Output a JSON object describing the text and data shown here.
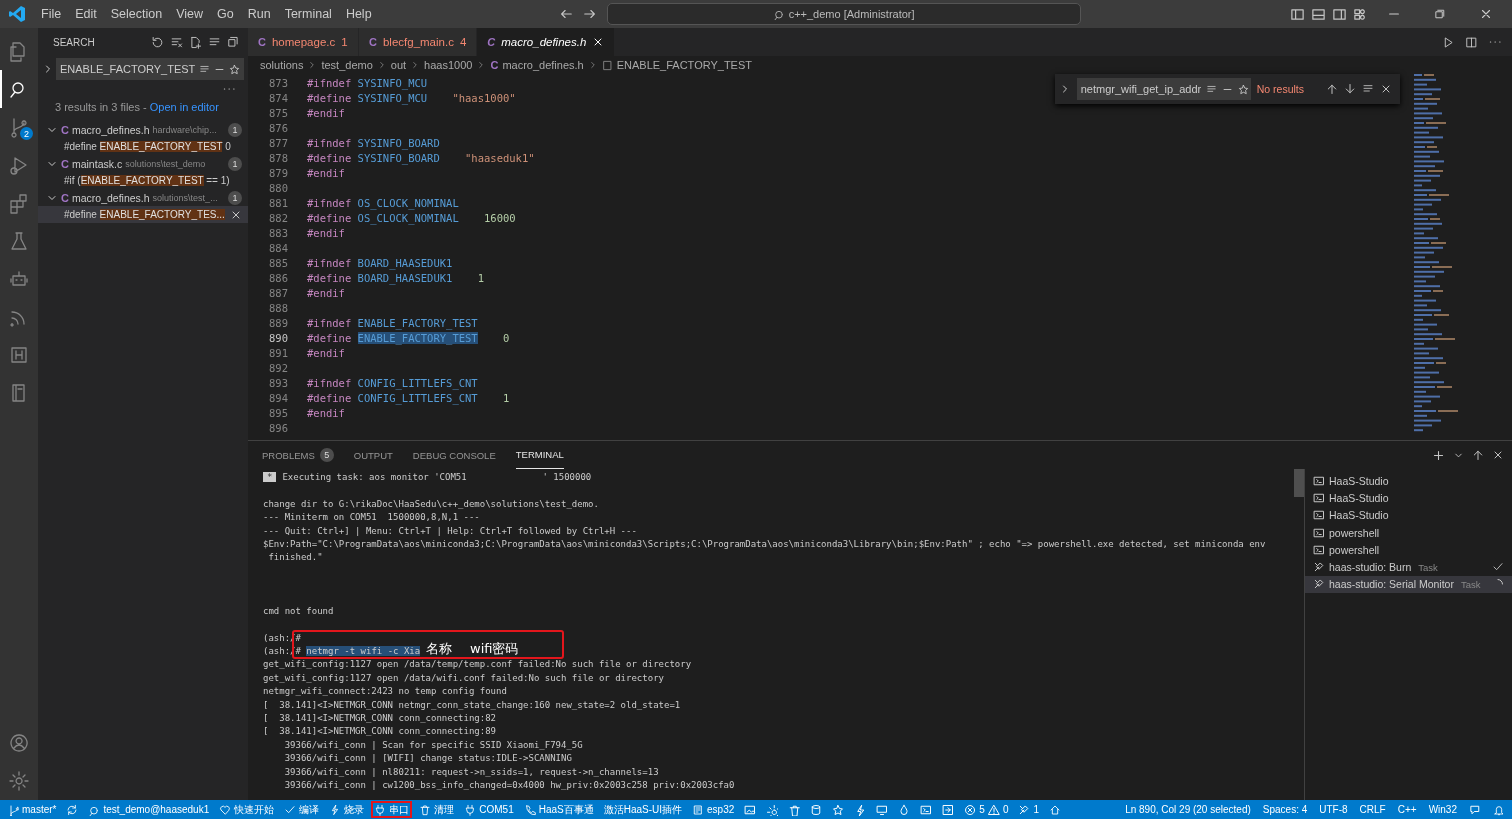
{
  "menu": [
    "File",
    "Edit",
    "Selection",
    "View",
    "Go",
    "Run",
    "Terminal",
    "Help"
  ],
  "command_center": "c++_demo [Administrator]",
  "activity": {
    "scm_badge": "2"
  },
  "sidebar": {
    "title": "SEARCH",
    "query": "ENABLE_FACTORY_TEST",
    "summary": "3 results in 3 files - ",
    "summary_link": "Open in editor",
    "results": [
      {
        "icon_text": "C",
        "file": "macro_defines.h",
        "path": "hardware\\chip...",
        "count": "1",
        "expanded": true,
        "matches": [
          {
            "before": "#define ",
            "match": "ENABLE_FACTORY_TEST",
            "after": "0",
            "selected": false
          }
        ]
      },
      {
        "icon_text": "C",
        "file": "maintask.c",
        "path": "solutions\\test_demo",
        "count": "1",
        "expanded": true,
        "matches": [
          {
            "before": "#if (",
            "match": "ENABLE_FACTORY_TEST",
            "after": "== 1)",
            "selected": false
          }
        ]
      },
      {
        "icon_text": "C",
        "file": "macro_defines.h",
        "path": "solutions\\test_...",
        "count": "1",
        "expanded": true,
        "matches": [
          {
            "before": "#define ",
            "match": "ENABLE_FACTORY_TES...",
            "selected": true
          }
        ]
      }
    ]
  },
  "tabs": [
    {
      "icon_text": "C",
      "label": "homepage.c",
      "badge": "1",
      "selected": false,
      "has_errors": true
    },
    {
      "icon_text": "C",
      "label": "blecfg_main.c",
      "badge": "4",
      "selected": false,
      "has_errors": true
    },
    {
      "icon_text": "C",
      "label": "macro_defines.h",
      "selected": true,
      "has_errors": false
    }
  ],
  "breadcrumb": [
    {
      "text": "solutions"
    },
    {
      "text": "test_demo"
    },
    {
      "text": "out"
    },
    {
      "text": "haas1000"
    },
    {
      "text": "macro_defines.h",
      "icon_text": "C"
    },
    {
      "text": "ENABLE_FACTORY_TEST",
      "kind": "symbol"
    }
  ],
  "find": {
    "query": "netmgr_wifi_get_ip_addr",
    "status": "No results"
  },
  "code": [
    {
      "n": "873",
      "kind": "guard",
      "directive": "#ifndef",
      "name": "SYSINFO_MCU",
      "current": false
    },
    {
      "n": "874",
      "kind": "string_define",
      "directive": "#define",
      "name": "SYSINFO_MCU",
      "value": "\"haas1000\"",
      "current": false
    },
    {
      "n": "875",
      "kind": "end",
      "directive": "#endif",
      "current": false
    },
    {
      "n": "876",
      "kind": "blank",
      "current": false
    },
    {
      "n": "877",
      "kind": "guard",
      "directive": "#ifndef",
      "name": "SYSINFO_BOARD",
      "current": false
    },
    {
      "n": "878",
      "kind": "string_define",
      "directive": "#define",
      "name": "SYSINFO_BOARD",
      "value": "\"haaseduk1\"",
      "current": false
    },
    {
      "n": "879",
      "kind": "end",
      "directive": "#endif",
      "current": false
    },
    {
      "n": "880",
      "kind": "blank",
      "current": false
    },
    {
      "n": "881",
      "kind": "guard",
      "directive": "#ifndef",
      "name": "OS_CLOCK_NOMINAL",
      "current": false
    },
    {
      "n": "882",
      "kind": "number_define",
      "directive": "#define",
      "name": "OS_CLOCK_NOMINAL",
      "value": "16000",
      "current": false
    },
    {
      "n": "883",
      "kind": "end",
      "directive": "#endif",
      "current": false
    },
    {
      "n": "884",
      "kind": "blank",
      "current": false
    },
    {
      "n": "885",
      "kind": "guard",
      "directive": "#ifndef",
      "name": "BOARD_HAASEDUK1",
      "current": false
    },
    {
      "n": "886",
      "kind": "number_define",
      "directive": "#define",
      "name": "BOARD_HAASEDUK1",
      "value": "1",
      "current": false
    },
    {
      "n": "887",
      "kind": "end",
      "directive": "#endif",
      "current": false
    },
    {
      "n": "888",
      "kind": "blank",
      "current": false
    },
    {
      "n": "889",
      "kind": "guard",
      "directive": "#ifndef",
      "name": "ENABLE_FACTORY_TEST",
      "current": false
    },
    {
      "n": "890",
      "kind": "number_define",
      "directive": "#define",
      "name": "ENABLE_FACTORY_TEST",
      "value": "0",
      "current": true
    },
    {
      "n": "891",
      "kind": "end",
      "directive": "#endif",
      "current": false
    },
    {
      "n": "892",
      "kind": "blank",
      "current": false
    },
    {
      "n": "893",
      "kind": "guard",
      "directive": "#ifndef",
      "name": "CONFIG_LITTLEFS_CNT",
      "current": false
    },
    {
      "n": "894",
      "kind": "number_define",
      "directive": "#define",
      "name": "CONFIG_LITTLEFS_CNT",
      "value": "1",
      "current": false
    },
    {
      "n": "895",
      "kind": "end",
      "directive": "#endif",
      "current": false
    },
    {
      "n": "896",
      "kind": "blank",
      "current": false
    }
  ],
  "panel": {
    "tabs": [
      {
        "label": "PROBLEMS",
        "badge": "5",
        "selected": false
      },
      {
        "label": "OUTPUT",
        "selected": false
      },
      {
        "label": "DEBUG CONSOLE",
        "selected": false
      },
      {
        "label": "TERMINAL",
        "selected": true
      }
    ],
    "terminal": {
      "lines": [
        {
          "kind": "task",
          "badge": "*",
          "text": "Executing task: aos monitor 'COM51              ' 1500000"
        },
        {
          "kind": "blank"
        },
        {
          "kind": "plain",
          "text": "change dir to G:\\rikaDoc\\HaaSedu\\c++_demo\\solutions\\test_demo."
        },
        {
          "kind": "plain",
          "text": "--- Miniterm on COM51  1500000,8,N,1 ---"
        },
        {
          "kind": "plain",
          "text": "--- Quit: Ctrl+] | Menu: Ctrl+T | Help: Ctrl+T followed by Ctrl+H ---"
        },
        {
          "kind": "plain",
          "text": "$Env:Path=\"C:\\ProgramData\\aos\\miniconda3;C:\\ProgramData\\aos\\miniconda3\\Scripts;C:\\ProgramData\\aos\\miniconda3\\Library\\bin;$Env:Path\" ; echo \"=> powershell.exe detected, set miniconda env"
        },
        {
          "kind": "plain",
          "text": " finished.\""
        },
        {
          "kind": "blank"
        },
        {
          "kind": "blank"
        },
        {
          "kind": "blank"
        },
        {
          "kind": "plain",
          "text": "cmd not found"
        },
        {
          "kind": "blank"
        },
        {
          "kind": "plain",
          "text": "(ash:/#"
        },
        {
          "kind": "command",
          "prompt": "(ash:/# ",
          "text": "netmgr -t wifi -c Xia"
        },
        {
          "kind": "plain",
          "text": "get_wifi_config:1127 open /data/temp/temp.conf failed:No such file or directory"
        },
        {
          "kind": "plain",
          "text": "get_wifi_config:1127 open /data/wifi.conf failed:No such file or directory"
        },
        {
          "kind": "plain",
          "text": "netmgr_wifi_connect:2423 no temp config found"
        },
        {
          "kind": "plain",
          "text": "[  38.141]<I>NETMGR_CONN netmgr_conn_state_change:160 new_state=2 old_state=1"
        },
        {
          "kind": "plain",
          "text": "[  38.141]<I>NETMGR_CONN conn_connecting:82"
        },
        {
          "kind": "plain",
          "text": "[  38.141]<I>NETMGR_CONN conn_connecting:89"
        },
        {
          "kind": "plain",
          "text": "    39366/wifi_conn | Scan for specific SSID Xiaomi_F794_5G"
        },
        {
          "kind": "plain",
          "text": "    39366/wifi_conn | [WIFI] change status:IDLE->SCANNING"
        },
        {
          "kind": "plain",
          "text": "    39366/wifi_conn | nl80211: request->n_ssids=1, request->n_channels=13"
        },
        {
          "kind": "plain",
          "text": "    39366/wifi_conn | cw1200_bss_info_changed=0x4000 hw_priv:0x2003c258 priv:0x2003cfa0"
        }
      ]
    },
    "annotation": {
      "labels": [
        "名称",
        "wifi密码"
      ]
    },
    "terminals": [
      {
        "label": "HaaS-Studio",
        "kind": "shell",
        "finished": false,
        "running": false,
        "selected": false
      },
      {
        "label": "HaaS-Studio",
        "kind": "shell",
        "finished": false,
        "running": false,
        "selected": false
      },
      {
        "label": "HaaS-Studio",
        "kind": "shell",
        "finished": false,
        "running": false,
        "selected": false
      },
      {
        "label": "powershell",
        "kind": "shell",
        "finished": false,
        "running": false,
        "selected": false
      },
      {
        "label": "powershell",
        "kind": "shell",
        "finished": false,
        "running": false,
        "selected": false
      },
      {
        "label": "haas-studio: Burn",
        "sublabel": "Task",
        "kind": "task",
        "finished": true,
        "running": false,
        "selected": false
      },
      {
        "label": "haas-studio: Serial Monitor",
        "sublabel": "Task",
        "kind": "task",
        "finished": false,
        "running": true,
        "selected": true
      }
    ]
  },
  "status_bar": {
    "left": [
      {
        "text": "master*",
        "highlighted": false
      },
      {
        "text": "test_demo@haaseduk1",
        "highlighted": false
      },
      {
        "text": "快速开始",
        "highlighted": false
      },
      {
        "text": "编译",
        "highlighted": false
      },
      {
        "text": "烧录",
        "highlighted": false
      },
      {
        "text": "串口",
        "highlighted": true
      },
      {
        "text": "清理",
        "highlighted": false
      },
      {
        "text": "COM51",
        "highlighted": false
      },
      {
        "text": "HaaS百事通",
        "highlighted": false
      },
      {
        "text": "激活HaaS-UI插件",
        "highlighted": false
      },
      {
        "text": "esp32",
        "highlighted": false
      }
    ],
    "errors": "5",
    "warnings": "0",
    "tools": "1",
    "right": [
      "Ln 890, Col 29 (20 selected)",
      "Spaces: 4",
      "UTF-8",
      "CRLF",
      "C++",
      "Win32"
    ]
  }
}
